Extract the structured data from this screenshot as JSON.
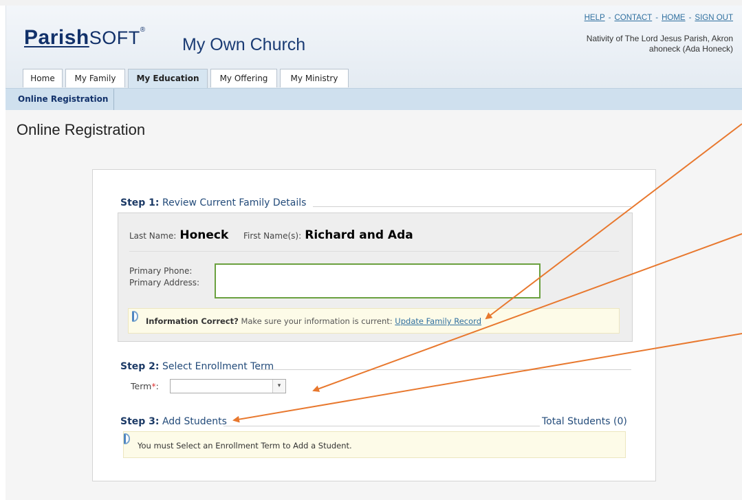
{
  "header": {
    "logo_part1": "Parish",
    "logo_part2": "SOFT",
    "logo_mark": "®",
    "church_name": "My Own Church",
    "links": [
      "HELP",
      "CONTACT",
      "HOME",
      "SIGN OUT"
    ],
    "link_separator": "-",
    "parish_name": "Nativity of The Lord Jesus Parish, Akron",
    "user": "ahoneck (Ada Honeck)"
  },
  "tabs": [
    "Home",
    "My Family",
    "My Education",
    "My Offering",
    "My Ministry"
  ],
  "subnav": {
    "item": "Online Registration"
  },
  "page": {
    "title": "Online Registration"
  },
  "step1": {
    "label": "Step 1:",
    "title": "Review Current Family Details",
    "last_name_label": "Last Name:",
    "last_name": "Honeck",
    "first_names_label": "First Name(s):",
    "first_names": "Richard and Ada",
    "phone_label": "Primary Phone:",
    "address_label": "Primary Address:",
    "notice_bold": "Information Correct?",
    "notice_text": "Make sure your information is current:",
    "notice_link": "Update Family Record"
  },
  "step2": {
    "label": "Step 2:",
    "title": "Select Enrollment Term",
    "term_label": "Term",
    "required_mark": "*",
    "term_colon": ":",
    "term_value": "",
    "arrow": "▾"
  },
  "step3": {
    "label": "Step 3:",
    "title": "Add Students",
    "total": "Total Students (0)",
    "notice": "You must Select an Enrollment Term to Add a Student."
  },
  "colors": {
    "accent": "#12316a",
    "annotation_arrow": "#e8782e",
    "highlight_box": "#6aa03e"
  }
}
